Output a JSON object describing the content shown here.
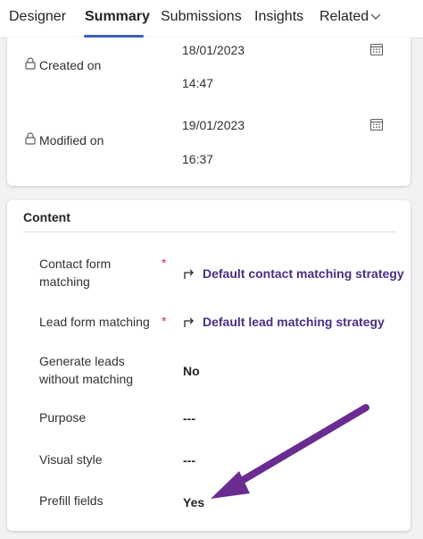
{
  "tabs": [
    {
      "label": "Designer"
    },
    {
      "label": "Summary"
    },
    {
      "label": "Submissions"
    },
    {
      "label": "Insights"
    },
    {
      "label": "Related"
    }
  ],
  "created": {
    "label": "Created on",
    "date": "18/01/2023",
    "time": "14:47"
  },
  "modified": {
    "label": "Modified on",
    "date": "19/01/2023",
    "time": "16:37"
  },
  "content": {
    "title": "Content",
    "required_mark": "*",
    "contact_matching": {
      "label_line1": "Contact form",
      "label_line2": "matching",
      "value": "Default contact matching strategy"
    },
    "lead_matching": {
      "label": "Lead form matching",
      "value": "Default lead matching strategy"
    },
    "generate_leads": {
      "label_line1": "Generate leads",
      "label_line2": "without matching",
      "value": "No"
    },
    "purpose": {
      "label": "Purpose",
      "value": "---"
    },
    "visual_style": {
      "label": "Visual style",
      "value": "---"
    },
    "prefill": {
      "label": "Prefill fields",
      "value": "Yes"
    }
  },
  "colors": {
    "accent": "#3b63b8",
    "link": "#4b2e83",
    "required": "#c4314b",
    "annotation_arrow": "#6a2c91"
  }
}
